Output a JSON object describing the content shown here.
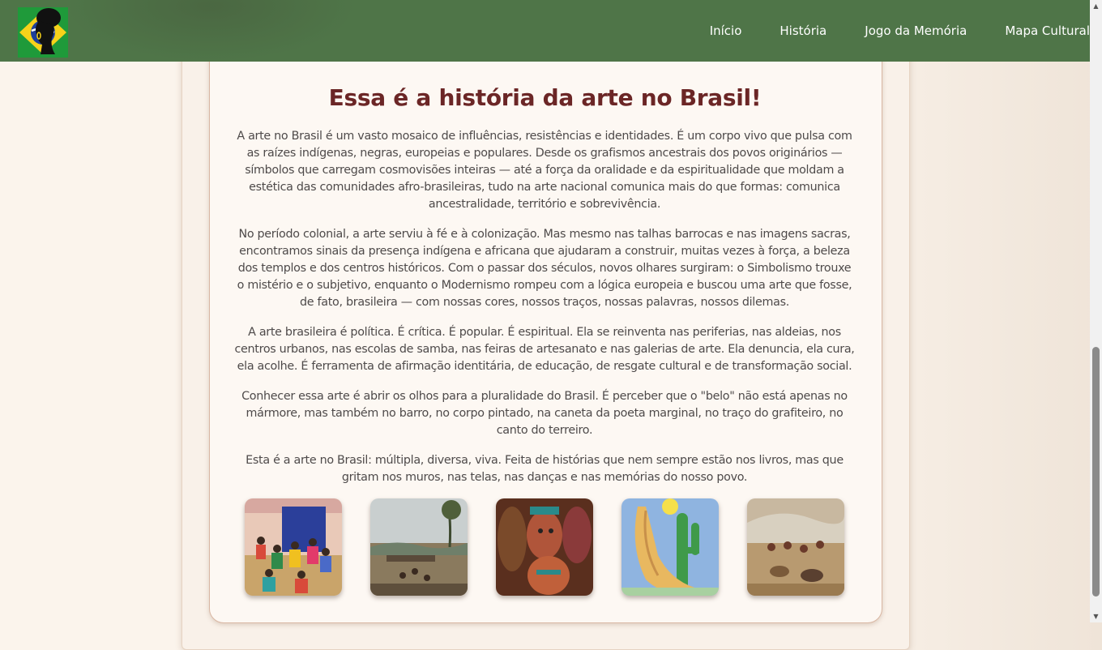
{
  "navbar": {
    "logo_icon": "woman-silhouette-brazil-flag-logo",
    "links": [
      {
        "label": "Início"
      },
      {
        "label": "História"
      },
      {
        "label": "Jogo da Memória"
      },
      {
        "label": "Mapa Cultural"
      }
    ],
    "background": "#4f7548"
  },
  "content": {
    "title": "Essa é a história da arte no Brasil!",
    "title_color": "#6b2626",
    "paragraphs": [
      "A arte no Brasil é um vasto mosaico de influências, resistências e identidades. É um corpo vivo que pulsa com as raízes indígenas, negras, europeias e populares. Desde os grafismos ancestrais dos povos originários — símbolos que carregam cosmovisões inteiras — até a força da oralidade e da espiritualidade que moldam a estética das comunidades afro-brasileiras, tudo na arte nacional comunica mais do que formas: comunica ancestralidade, território e sobrevivência.",
      "No período colonial, a arte serviu à fé e à colonização. Mas mesmo nas talhas barrocas e nas imagens sacras, encontramos sinais da presença indígena e africana que ajudaram a construir, muitas vezes à força, a beleza dos templos e dos centros históricos. Com o passar dos séculos, novos olhares surgiram: o Simbolismo trouxe o mistério e o subjetivo, enquanto o Modernismo rompeu com a lógica europeia e buscou uma arte que fosse, de fato, brasileira — com nossas cores, nossos traços, nossas palavras, nossos dilemas.",
      "A arte brasileira é política. É crítica. É popular. É espiritual. Ela se reinventa nas periferias, nas aldeias, nos centros urbanos, nas escolas de samba, nas feiras de artesanato e nas galerias de arte. Ela denuncia, ela cura, ela acolhe. É ferramenta de afirmação identitária, de educação, de resgate cultural e de transformação social.",
      "Conhecer essa arte é abrir os olhos para a pluralidade do Brasil. É perceber que o \"belo\" não está apenas no mármore, mas também no barro, no corpo pintado, na caneta da poeta marginal, no traço do grafiteiro, no canto do terreiro.",
      "Esta é a arte no Brasil: múltipla, diversa, viva. Feita de histórias que nem sempre estão nos livros, mas que gritam nos muros, nas telas, nas danças e nas memórias do nosso povo."
    ]
  },
  "gallery": [
    {
      "icon": "folk-dance-painting-image"
    },
    {
      "icon": "colonial-landscape-painting-image"
    },
    {
      "icon": "carved-wooden-masks-image"
    },
    {
      "icon": "abaporu-cactus-painting-image"
    },
    {
      "icon": "battle-scene-painting-image"
    }
  ]
}
